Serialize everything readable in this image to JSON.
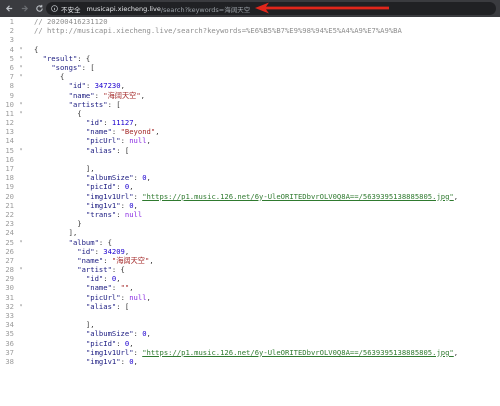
{
  "browser": {
    "security_label": "不安全",
    "url_host": "musicapi.xiecheng.live",
    "url_path": "/search?keywords=海阔天空"
  },
  "editor": {
    "lines": [
      {
        "n": "1",
        "f": "",
        "t": [
          [
            "c-comment",
            "// 20200416231120"
          ]
        ]
      },
      {
        "n": "2",
        "f": "",
        "t": [
          [
            "c-comment",
            "// http://musicapi.xiecheng.live/search?keywords=%E6%B5%B7%E9%98%94%E5%A4%A9%E7%A9%BA"
          ]
        ]
      },
      {
        "n": "3",
        "f": "",
        "t": []
      },
      {
        "n": "4",
        "f": "▾",
        "t": [
          [
            "c-punc",
            "{"
          ]
        ]
      },
      {
        "n": "5",
        "f": "▾",
        "t": [
          [
            "c-punc",
            "  "
          ],
          [
            "c-key",
            "\"result\""
          ],
          [
            "c-punc",
            ": {"
          ]
        ]
      },
      {
        "n": "6",
        "f": "▾",
        "t": [
          [
            "c-punc",
            "    "
          ],
          [
            "c-key",
            "\"songs\""
          ],
          [
            "c-punc",
            ": ["
          ]
        ]
      },
      {
        "n": "7",
        "f": "▾",
        "t": [
          [
            "c-punc",
            "      {"
          ]
        ]
      },
      {
        "n": "8",
        "f": "",
        "t": [
          [
            "c-punc",
            "        "
          ],
          [
            "c-key",
            "\"id\""
          ],
          [
            "c-punc",
            ": "
          ],
          [
            "c-num",
            "347230"
          ],
          [
            "c-punc",
            ","
          ]
        ]
      },
      {
        "n": "9",
        "f": "",
        "t": [
          [
            "c-punc",
            "        "
          ],
          [
            "c-key",
            "\"name\""
          ],
          [
            "c-punc",
            ": "
          ],
          [
            "c-str",
            "\"海阔天空\""
          ],
          [
            "c-punc",
            ","
          ]
        ]
      },
      {
        "n": "10",
        "f": "▾",
        "t": [
          [
            "c-punc",
            "        "
          ],
          [
            "c-key",
            "\"artists\""
          ],
          [
            "c-punc",
            ": ["
          ]
        ]
      },
      {
        "n": "11",
        "f": "▾",
        "t": [
          [
            "c-punc",
            "          {"
          ]
        ]
      },
      {
        "n": "12",
        "f": "",
        "t": [
          [
            "c-punc",
            "            "
          ],
          [
            "c-key",
            "\"id\""
          ],
          [
            "c-punc",
            ": "
          ],
          [
            "c-num",
            "11127"
          ],
          [
            "c-punc",
            ","
          ]
        ]
      },
      {
        "n": "13",
        "f": "",
        "t": [
          [
            "c-punc",
            "            "
          ],
          [
            "c-key",
            "\"name\""
          ],
          [
            "c-punc",
            ": "
          ],
          [
            "c-str",
            "\"Beyond\""
          ],
          [
            "c-punc",
            ","
          ]
        ]
      },
      {
        "n": "14",
        "f": "",
        "t": [
          [
            "c-punc",
            "            "
          ],
          [
            "c-key",
            "\"picUrl\""
          ],
          [
            "c-punc",
            ": "
          ],
          [
            "c-lit",
            "null"
          ],
          [
            "c-punc",
            ","
          ]
        ]
      },
      {
        "n": "15",
        "f": "▾",
        "t": [
          [
            "c-punc",
            "            "
          ],
          [
            "c-key",
            "\"alias\""
          ],
          [
            "c-punc",
            ": ["
          ]
        ]
      },
      {
        "n": "16",
        "f": "",
        "t": []
      },
      {
        "n": "17",
        "f": "",
        "t": [
          [
            "c-punc",
            "            ],"
          ]
        ]
      },
      {
        "n": "18",
        "f": "",
        "t": [
          [
            "c-punc",
            "            "
          ],
          [
            "c-key",
            "\"albumSize\""
          ],
          [
            "c-punc",
            ": "
          ],
          [
            "c-num",
            "0"
          ],
          [
            "c-punc",
            ","
          ]
        ]
      },
      {
        "n": "19",
        "f": "",
        "t": [
          [
            "c-punc",
            "            "
          ],
          [
            "c-key",
            "\"picId\""
          ],
          [
            "c-punc",
            ": "
          ],
          [
            "c-num",
            "0"
          ],
          [
            "c-punc",
            ","
          ]
        ]
      },
      {
        "n": "20",
        "f": "",
        "t": [
          [
            "c-punc",
            "            "
          ],
          [
            "c-key",
            "\"img1v1Url\""
          ],
          [
            "c-punc",
            ": "
          ],
          [
            "c-link",
            "\"https://p1.music.126.net/6y-UleORITEDbvrOLV0Q8A==/5639395138885805.jpg\""
          ],
          [
            "c-punc",
            ","
          ]
        ]
      },
      {
        "n": "21",
        "f": "",
        "t": [
          [
            "c-punc",
            "            "
          ],
          [
            "c-key",
            "\"img1v1\""
          ],
          [
            "c-punc",
            ": "
          ],
          [
            "c-num",
            "0"
          ],
          [
            "c-punc",
            ","
          ]
        ]
      },
      {
        "n": "22",
        "f": "",
        "t": [
          [
            "c-punc",
            "            "
          ],
          [
            "c-key",
            "\"trans\""
          ],
          [
            "c-punc",
            ": "
          ],
          [
            "c-lit",
            "null"
          ]
        ]
      },
      {
        "n": "23",
        "f": "",
        "t": [
          [
            "c-punc",
            "          }"
          ]
        ]
      },
      {
        "n": "24",
        "f": "",
        "t": [
          [
            "c-punc",
            "        ],"
          ]
        ]
      },
      {
        "n": "25",
        "f": "▾",
        "t": [
          [
            "c-punc",
            "        "
          ],
          [
            "c-key",
            "\"album\""
          ],
          [
            "c-punc",
            ": {"
          ]
        ]
      },
      {
        "n": "26",
        "f": "",
        "t": [
          [
            "c-punc",
            "          "
          ],
          [
            "c-key",
            "\"id\""
          ],
          [
            "c-punc",
            ": "
          ],
          [
            "c-num",
            "34209"
          ],
          [
            "c-punc",
            ","
          ]
        ]
      },
      {
        "n": "27",
        "f": "",
        "t": [
          [
            "c-punc",
            "          "
          ],
          [
            "c-key",
            "\"name\""
          ],
          [
            "c-punc",
            ": "
          ],
          [
            "c-str",
            "\"海阔天空\""
          ],
          [
            "c-punc",
            ","
          ]
        ]
      },
      {
        "n": "28",
        "f": "▾",
        "t": [
          [
            "c-punc",
            "          "
          ],
          [
            "c-key",
            "\"artist\""
          ],
          [
            "c-punc",
            ": {"
          ]
        ]
      },
      {
        "n": "29",
        "f": "",
        "t": [
          [
            "c-punc",
            "            "
          ],
          [
            "c-key",
            "\"id\""
          ],
          [
            "c-punc",
            ": "
          ],
          [
            "c-num",
            "0"
          ],
          [
            "c-punc",
            ","
          ]
        ]
      },
      {
        "n": "30",
        "f": "",
        "t": [
          [
            "c-punc",
            "            "
          ],
          [
            "c-key",
            "\"name\""
          ],
          [
            "c-punc",
            ": "
          ],
          [
            "c-str",
            "\"\""
          ],
          [
            "c-punc",
            ","
          ]
        ]
      },
      {
        "n": "31",
        "f": "",
        "t": [
          [
            "c-punc",
            "            "
          ],
          [
            "c-key",
            "\"picUrl\""
          ],
          [
            "c-punc",
            ": "
          ],
          [
            "c-lit",
            "null"
          ],
          [
            "c-punc",
            ","
          ]
        ]
      },
      {
        "n": "32",
        "f": "▾",
        "t": [
          [
            "c-punc",
            "            "
          ],
          [
            "c-key",
            "\"alias\""
          ],
          [
            "c-punc",
            ": ["
          ]
        ]
      },
      {
        "n": "33",
        "f": "",
        "t": []
      },
      {
        "n": "34",
        "f": "",
        "t": [
          [
            "c-punc",
            "            ],"
          ]
        ]
      },
      {
        "n": "35",
        "f": "",
        "t": [
          [
            "c-punc",
            "            "
          ],
          [
            "c-key",
            "\"albumSize\""
          ],
          [
            "c-punc",
            ": "
          ],
          [
            "c-num",
            "0"
          ],
          [
            "c-punc",
            ","
          ]
        ]
      },
      {
        "n": "36",
        "f": "",
        "t": [
          [
            "c-punc",
            "            "
          ],
          [
            "c-key",
            "\"picId\""
          ],
          [
            "c-punc",
            ": "
          ],
          [
            "c-num",
            "0"
          ],
          [
            "c-punc",
            ","
          ]
        ]
      },
      {
        "n": "37",
        "f": "",
        "t": [
          [
            "c-punc",
            "            "
          ],
          [
            "c-key",
            "\"img1v1Url\""
          ],
          [
            "c-punc",
            ": "
          ],
          [
            "c-link",
            "\"https://p1.music.126.net/6y-UleORITEDbvrOLV0Q8A==/5639395138885805.jpg\""
          ],
          [
            "c-punc",
            ","
          ]
        ]
      },
      {
        "n": "38",
        "f": "",
        "t": [
          [
            "c-punc",
            "            "
          ],
          [
            "c-key",
            "\"img1v1\""
          ],
          [
            "c-punc",
            ": "
          ],
          [
            "c-num",
            "0"
          ],
          [
            "c-punc",
            ","
          ]
        ]
      }
    ]
  }
}
